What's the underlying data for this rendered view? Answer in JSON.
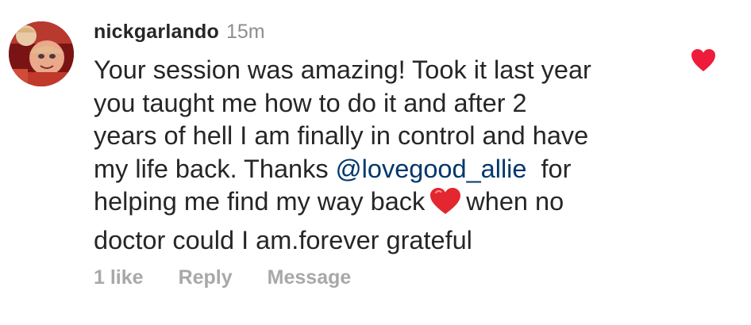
{
  "comment": {
    "username": "nickgarlando",
    "timestamp": "15m",
    "text_parts": {
      "line1": "Your session was amazing! Took it last year",
      "line2": "you taught me how to do it and after 2",
      "line3": "years of hell I am finally in control and have",
      "line4_pre": "my life back. Thanks ",
      "mention": "@lovegood_allie",
      "line4_post": "  for",
      "line5_pre": "helping me find my way back",
      "line5_post": "when no",
      "line6": "doctor could I am.forever grateful"
    },
    "emoji": "red-heart",
    "liked": true
  },
  "actions": {
    "likes_label": "1 like",
    "reply_label": "Reply",
    "message_label": "Message"
  },
  "colors": {
    "text": "#262626",
    "muted": "#8e8e8e",
    "actions": "#a8a8a8",
    "mention": "#00376b",
    "heart": "#ed1c3b"
  },
  "icons": {
    "like": "heart-filled-icon",
    "emoji": "red-heart-emoji"
  }
}
